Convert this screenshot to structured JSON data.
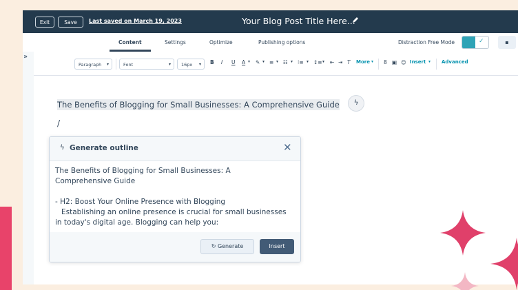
{
  "topbar": {
    "exit_label": "Exit",
    "save_label": "Save",
    "last_saved": "Last saved on March 19, 2023",
    "title": "Your Blog Post Title Here..."
  },
  "tabs": [
    {
      "label": "Content",
      "active": true
    },
    {
      "label": "Settings",
      "active": false
    },
    {
      "label": "Optimize",
      "active": false
    },
    {
      "label": "Publishing options",
      "active": false
    }
  ],
  "distraction_free": {
    "label": "Distraction Free Mode",
    "enabled": true
  },
  "toolbar": {
    "paragraph": "Paragraph",
    "font": "Font",
    "size": "16px",
    "bold": "B",
    "italic": "I",
    "underline": "U",
    "text_color": "A",
    "more": "More",
    "insert": "Insert",
    "advanced": "Advanced"
  },
  "editor": {
    "headline": "The Benefits of Blogging for Small Businesses: A Comprehensive Guide",
    "slash": "/"
  },
  "outline_panel": {
    "title": "Generate outline",
    "line1": "The Benefits of Blogging for Small Businesses: A",
    "line2": "Comprehensive Guide",
    "line3": "- H2: Boost Your Online Presence with Blogging",
    "line4": "Establishing an online presence is crucial for small businesses",
    "line5": "in today's digital age. Blogging can help you:",
    "generate_label": "Generate",
    "insert_label": "Insert"
  },
  "colors": {
    "topbar": "#233a4d",
    "toggle": "#2fa3b6",
    "accent_pink": "#e8436a",
    "insert_button": "#425b76"
  }
}
